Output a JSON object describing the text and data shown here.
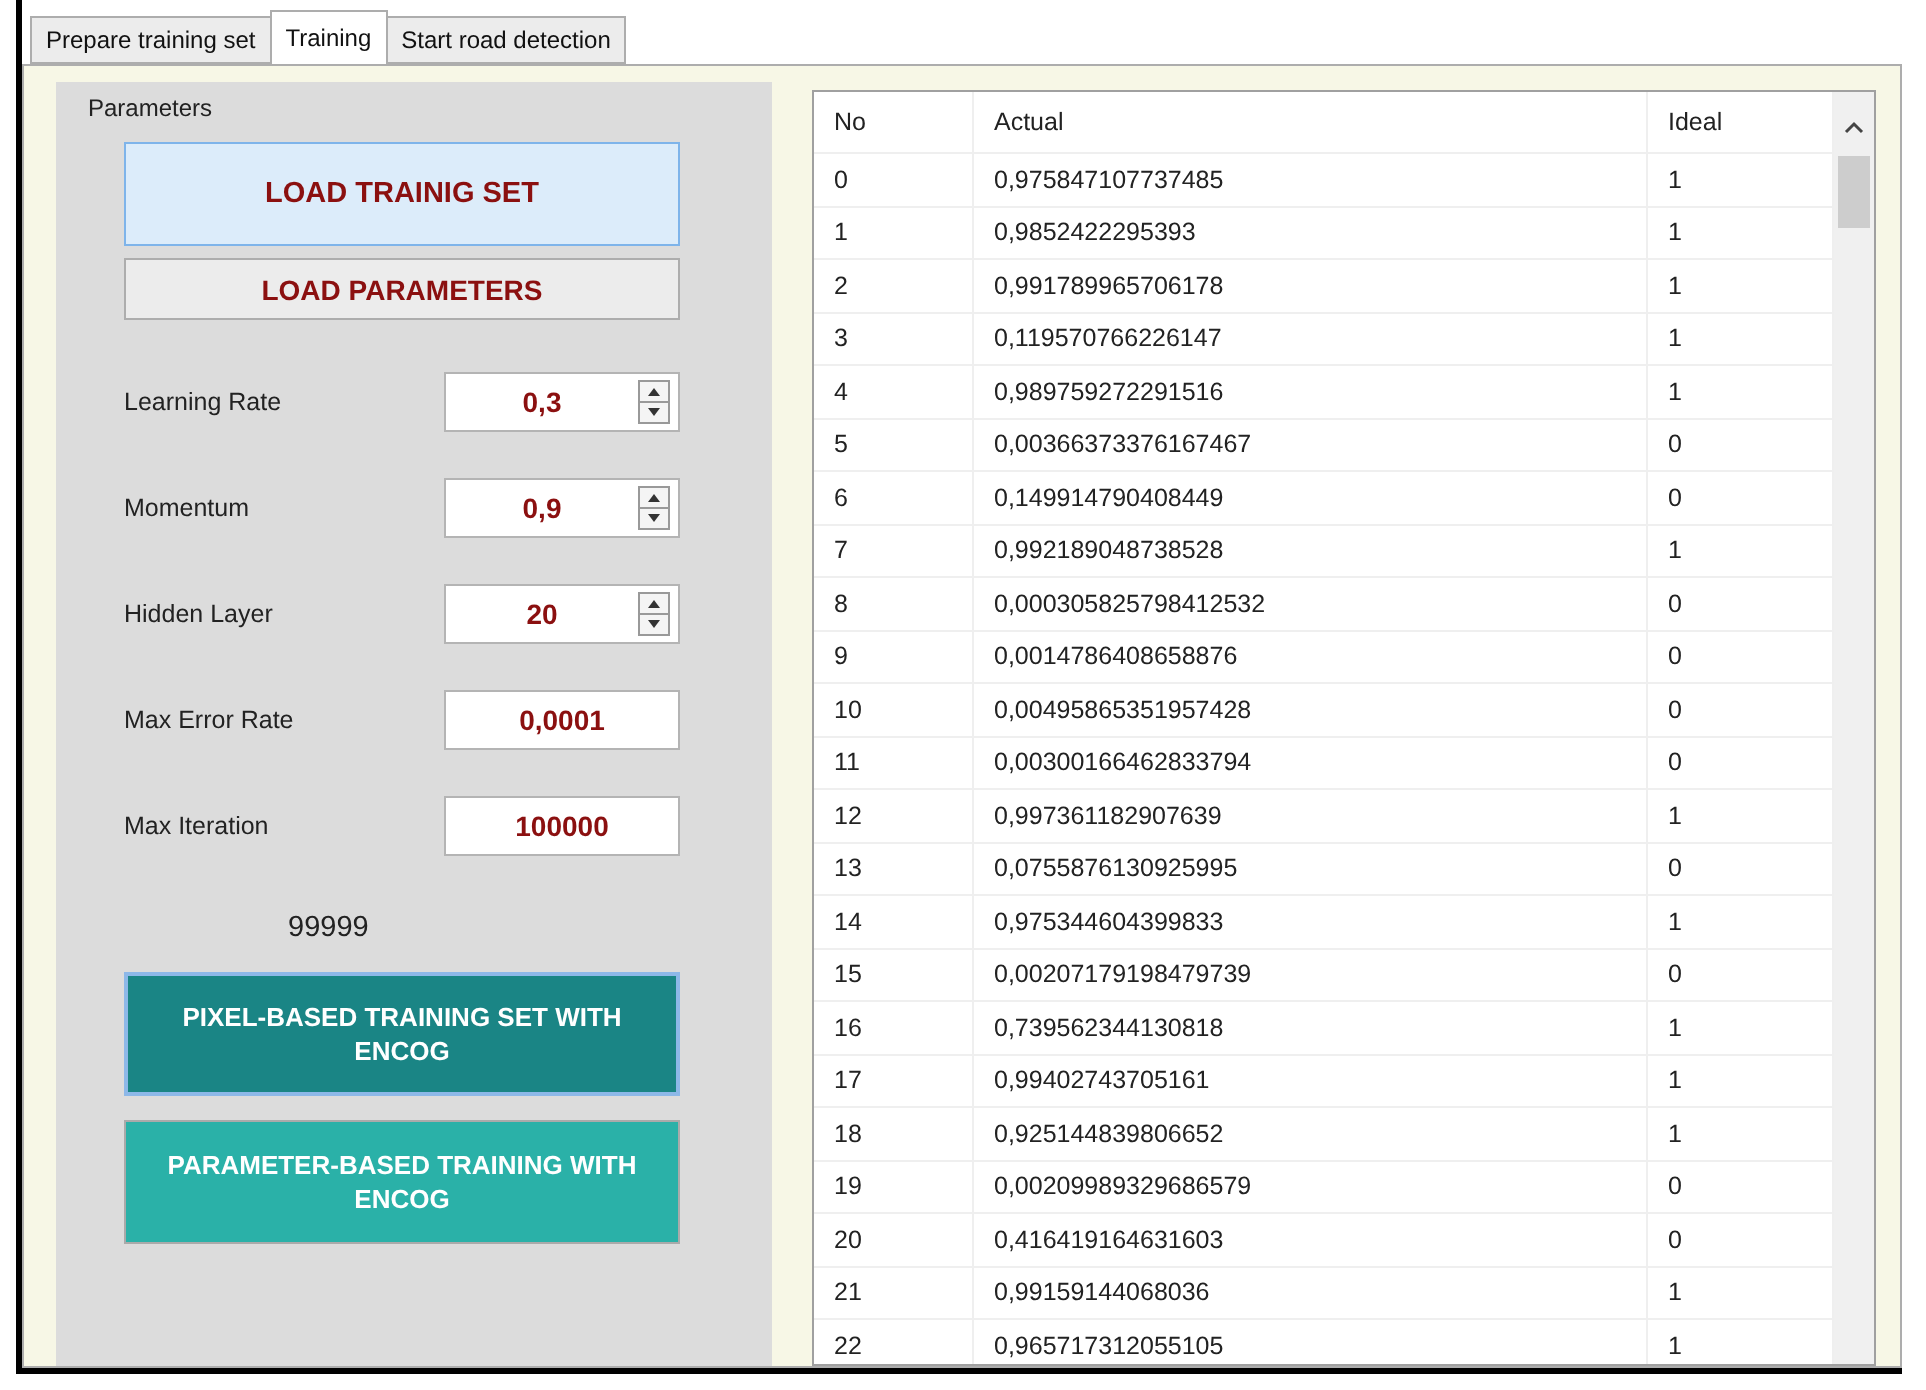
{
  "tabs": [
    {
      "label": "Prepare training set",
      "selected": false
    },
    {
      "label": "Training",
      "selected": true
    },
    {
      "label": "Start road detection",
      "selected": false
    }
  ],
  "parameters": {
    "title": "Parameters",
    "load_buttons": [
      {
        "label": "LOAD TRAINIG SET",
        "focused": true
      },
      {
        "label": "LOAD PARAMETERS",
        "focused": false
      }
    ],
    "fields": [
      {
        "label": "Learning Rate",
        "value": "0,3",
        "kind": "spinner"
      },
      {
        "label": "Momentum",
        "value": "0,9",
        "kind": "spinner"
      },
      {
        "label": "Hidden Layer",
        "value": "20",
        "kind": "spinner"
      },
      {
        "label": "Max Error Rate",
        "value": "0,0001",
        "kind": "text"
      },
      {
        "label": "Max Iteration",
        "value": "100000",
        "kind": "text"
      }
    ],
    "iteration_count": "99999",
    "train_buttons": [
      {
        "label": "PIXEL-BASED TRAINING SET WITH ENCOG",
        "focused": true
      },
      {
        "label": "PARAMETER-BASED TRAINING WITH ENCOG",
        "focused": false
      }
    ]
  },
  "table": {
    "columns": [
      "No",
      "Actual",
      "Ideal"
    ],
    "rows": [
      [
        "0",
        "0,975847107737485",
        "1"
      ],
      [
        "1",
        "0,9852422295393",
        "1"
      ],
      [
        "2",
        "0,991789965706178",
        "1"
      ],
      [
        "3",
        "0,119570766226147",
        "1"
      ],
      [
        "4",
        "0,989759272291516",
        "1"
      ],
      [
        "5",
        "0,00366373376167467",
        "0"
      ],
      [
        "6",
        "0,149914790408449",
        "0"
      ],
      [
        "7",
        "0,992189048738528",
        "1"
      ],
      [
        "8",
        "0,000305825798412532",
        "0"
      ],
      [
        "9",
        "0,0014786408658876",
        "0"
      ],
      [
        "10",
        "0,00495865351957428",
        "0"
      ],
      [
        "11",
        "0,00300166462833794",
        "0"
      ],
      [
        "12",
        "0,997361182907639",
        "1"
      ],
      [
        "13",
        "0,0755876130925995",
        "0"
      ],
      [
        "14",
        "0,975344604399833",
        "1"
      ],
      [
        "15",
        "0,00207179198479739",
        "0"
      ],
      [
        "16",
        "0,739562344130818",
        "1"
      ],
      [
        "17",
        "0,99402743705161",
        "1"
      ],
      [
        "18",
        "0,925144839806652",
        "1"
      ],
      [
        "19",
        "0,00209989329686579",
        "0"
      ],
      [
        "20",
        "0,416419164631603",
        "0"
      ],
      [
        "21",
        "0,99159144068036",
        "1"
      ],
      [
        "22",
        "0,965717312055105",
        "1"
      ]
    ]
  }
}
